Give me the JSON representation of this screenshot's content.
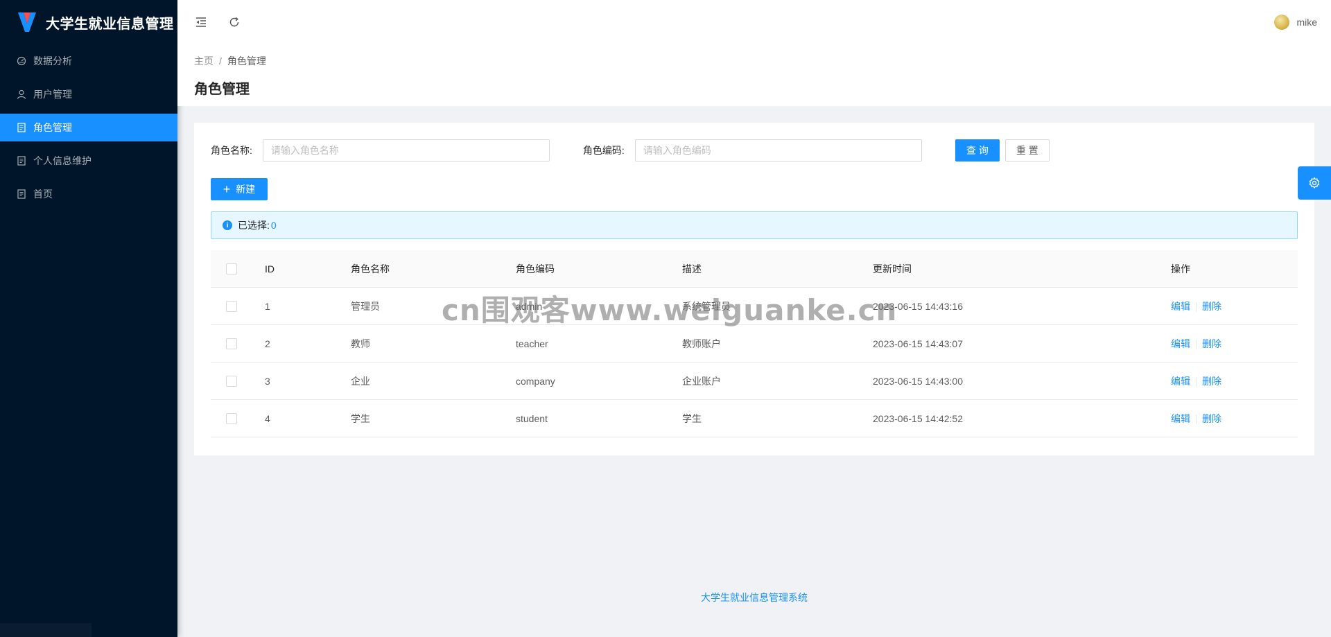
{
  "app": {
    "title": "大学生就业信息管理"
  },
  "sidebar": {
    "items": [
      {
        "label": "数据分析",
        "icon": "dashboard-icon",
        "active": false
      },
      {
        "label": "用户管理",
        "icon": "user-icon",
        "active": false
      },
      {
        "label": "角色管理",
        "icon": "file-icon",
        "active": true
      },
      {
        "label": "个人信息维护",
        "icon": "file-icon",
        "active": false
      },
      {
        "label": "首页",
        "icon": "file-icon",
        "active": false
      }
    ]
  },
  "header": {
    "collapse_icon": "menu-fold-icon",
    "refresh_icon": "reload-icon",
    "username": "mike"
  },
  "breadcrumb": {
    "home": "主页",
    "separator": "/",
    "current": "角色管理"
  },
  "page": {
    "title": "角色管理"
  },
  "search": {
    "role_name_label": "角色名称:",
    "role_name_placeholder": "请输入角色名称",
    "role_code_label": "角色编码:",
    "role_code_placeholder": "请输入角色编码",
    "query_label": "查 询",
    "reset_label": "重 置"
  },
  "toolbar": {
    "new_label": "新建"
  },
  "alert": {
    "selected_label": "已选择:",
    "selected_count": "0"
  },
  "table": {
    "columns": [
      "ID",
      "角色名称",
      "角色编码",
      "描述",
      "更新时间",
      "操作"
    ],
    "rows": [
      {
        "id": "1",
        "name": "管理员",
        "code": "admin",
        "desc": "系统管理员",
        "time": "2023-06-15 14:43:16"
      },
      {
        "id": "2",
        "name": "教师",
        "code": "teacher",
        "desc": "教师账户",
        "time": "2023-06-15 14:43:07"
      },
      {
        "id": "3",
        "name": "企业",
        "code": "company",
        "desc": "企业账户",
        "time": "2023-06-15 14:43:00"
      },
      {
        "id": "4",
        "name": "学生",
        "code": "student",
        "desc": "学生",
        "time": "2023-06-15 14:42:52"
      }
    ],
    "actions": {
      "edit": "编辑",
      "delete": "删除"
    }
  },
  "watermark": "cn围观客www.weiguanke.cn",
  "footer": {
    "text": "大学生就业信息管理系统"
  },
  "colors": {
    "primary": "#1890ff",
    "sidebar_bg": "#001529"
  }
}
